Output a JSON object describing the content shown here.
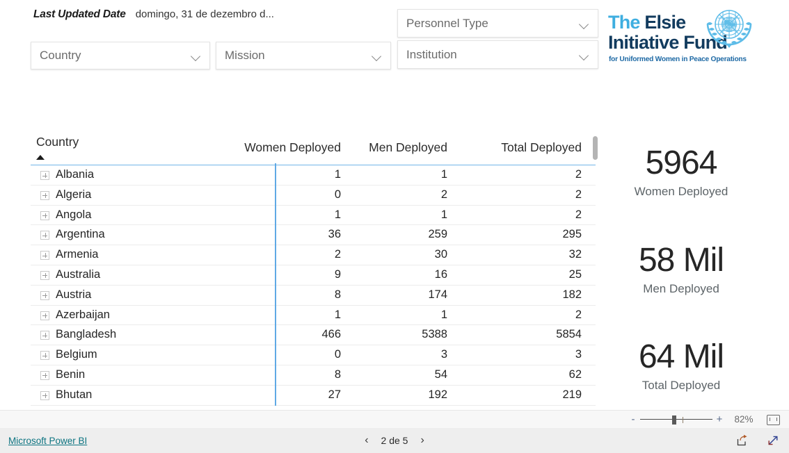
{
  "header": {
    "last_updated_label": "Last Updated Date",
    "last_updated_value": "domingo, 31 de dezembro d..."
  },
  "slicers": [
    {
      "name": "country",
      "label": "Country",
      "selected": "Country"
    },
    {
      "name": "mission",
      "label": "Mission",
      "selected": "Mission"
    },
    {
      "name": "personnel",
      "label": "Personnel Type",
      "selected": "Personnel Type"
    },
    {
      "name": "institution",
      "label": "Institution",
      "selected": "Institution"
    }
  ],
  "logo": {
    "line1_light": "The ",
    "line1_dark": "Elsie",
    "line2_dark": "Initiative Fund",
    "tagline": "for Uniformed Women in Peace Operations",
    "colors": {
      "light_blue": "#3eaee0",
      "dark_navy": "#123b5e",
      "tagline_blue": "#1f6aa5",
      "un_blue": "#5dbce8"
    },
    "emblem": "un-emblem-icon"
  },
  "table": {
    "columns": [
      "Country",
      "Women Deployed",
      "Men Deployed",
      "Total Deployed"
    ],
    "sort_column": "Country",
    "sort_direction": "ascending",
    "divider_color": "#5fa9e5",
    "rows": [
      {
        "country": "Albania",
        "women": "1",
        "men": "1",
        "total": "2"
      },
      {
        "country": "Algeria",
        "women": "0",
        "men": "2",
        "total": "2"
      },
      {
        "country": "Angola",
        "women": "1",
        "men": "1",
        "total": "2"
      },
      {
        "country": "Argentina",
        "women": "36",
        "men": "259",
        "total": "295"
      },
      {
        "country": "Armenia",
        "women": "2",
        "men": "30",
        "total": "32"
      },
      {
        "country": "Australia",
        "women": "9",
        "men": "16",
        "total": "25"
      },
      {
        "country": "Austria",
        "women": "8",
        "men": "174",
        "total": "182"
      },
      {
        "country": "Azerbaijan",
        "women": "1",
        "men": "1",
        "total": "2"
      },
      {
        "country": "Bangladesh",
        "women": "466",
        "men": "5388",
        "total": "5854"
      },
      {
        "country": "Belgium",
        "women": "0",
        "men": "3",
        "total": "3"
      },
      {
        "country": "Benin",
        "women": "8",
        "men": "54",
        "total": "62"
      },
      {
        "country": "Bhutan",
        "women": "27",
        "men": "192",
        "total": "219"
      }
    ]
  },
  "kpis": [
    {
      "name": "women-deployed",
      "value": "5964",
      "label": "Women Deployed"
    },
    {
      "name": "men-deployed",
      "value": "58 Mil",
      "label": "Men Deployed"
    },
    {
      "name": "total-deployed",
      "value": "64 Mil",
      "label": "Total Deployed"
    }
  ],
  "zoom_bar": {
    "minus": "-",
    "plus": "+",
    "percent": "82%",
    "fit_icon": "fit-to-page-icon"
  },
  "footer": {
    "brand_link": "Microsoft Power BI",
    "prev_icon": "chevron-left-icon",
    "next_icon": "chevron-right-icon",
    "page_indicator": "2 de 5",
    "share_icon": "share-export-icon",
    "fullscreen_icon": "fullscreen-expand-icon"
  }
}
